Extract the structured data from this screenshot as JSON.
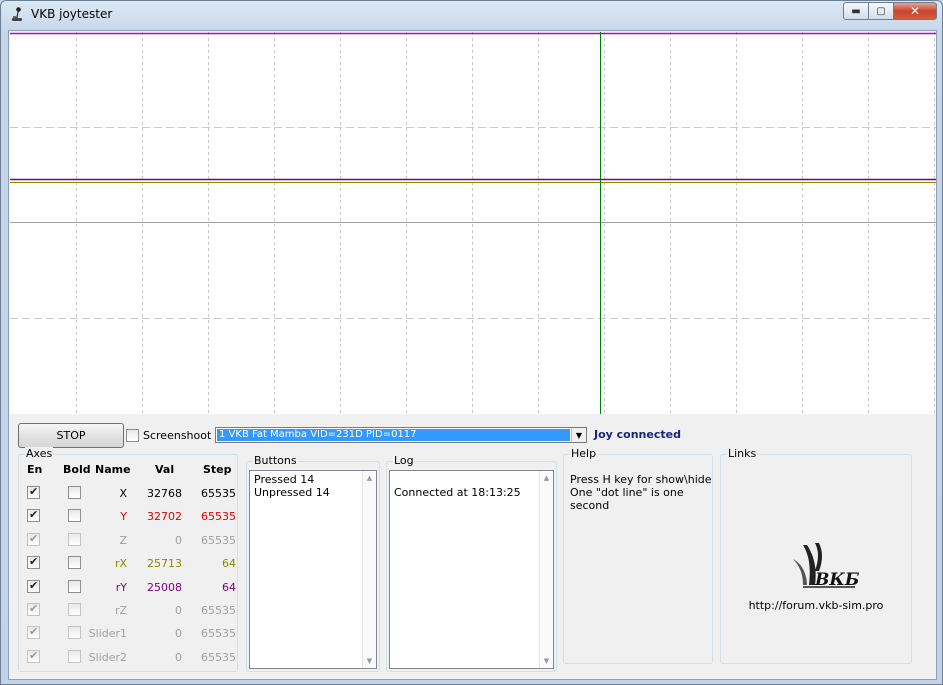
{
  "window": {
    "title": "VKB joytester"
  },
  "controls": {
    "stop_label": "STOP",
    "screenshot_label": "Screenshoot",
    "screenshot_checked": false,
    "device_value": "1 VKB Fat Mamba  VID=231D PID=0117",
    "status": "Joy connected"
  },
  "axes": {
    "legend": "Axes",
    "headers": {
      "en": "En",
      "bold": "Bold",
      "name": "Name",
      "val": "Val",
      "step": "Step"
    },
    "rows": [
      {
        "name": "X",
        "val": "32768",
        "step": "65535",
        "en": true,
        "bold": false,
        "color": "#000000",
        "enabled": true
      },
      {
        "name": "Y",
        "val": "32702",
        "step": "65535",
        "en": true,
        "bold": false,
        "color": "#e00000",
        "enabled": true
      },
      {
        "name": "Z",
        "val": "0",
        "step": "65535",
        "en": true,
        "bold": false,
        "color": "#a0a0a0",
        "enabled": false
      },
      {
        "name": "rX",
        "val": "25713",
        "step": "64",
        "en": true,
        "bold": false,
        "color": "#8a8a00",
        "enabled": true
      },
      {
        "name": "rY",
        "val": "25008",
        "step": "64",
        "en": true,
        "bold": false,
        "color": "#800080",
        "enabled": true
      },
      {
        "name": "rZ",
        "val": "0",
        "step": "65535",
        "en": true,
        "bold": false,
        "color": "#a0a0a0",
        "enabled": false
      },
      {
        "name": "Slider1",
        "val": "0",
        "step": "65535",
        "en": true,
        "bold": false,
        "color": "#a0a0a0",
        "enabled": false
      },
      {
        "name": "Slider2",
        "val": "0",
        "step": "65535",
        "en": true,
        "bold": false,
        "color": "#a0a0a0",
        "enabled": false
      }
    ]
  },
  "buttons": {
    "legend": "Buttons",
    "lines": [
      "Pressed 14",
      "Unpressed 14"
    ]
  },
  "log": {
    "legend": "Log",
    "lines": [
      "",
      "Connected at 18:13:25"
    ]
  },
  "help": {
    "legend": "Help",
    "lines": [
      "Press H key for show\\hide",
      "One \"dot line\" is one second"
    ]
  },
  "links": {
    "legend": "Links",
    "url": "http://forum.vkb-sim.pro",
    "logo_text": "ВКБ"
  },
  "graph_colors": {
    "top": "#c000c0",
    "purple": "#800080",
    "olive": "#8a8a00",
    "center": "#a0a0a0",
    "cursor": "#008000"
  }
}
